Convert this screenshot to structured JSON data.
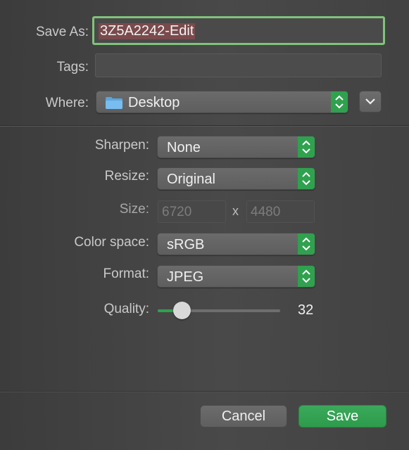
{
  "save_as": {
    "label": "Save As:",
    "value": "3Z5A2242-Edit"
  },
  "tags": {
    "label": "Tags:",
    "value": ""
  },
  "where": {
    "label": "Where:",
    "value": "Desktop",
    "icon": "folder-icon"
  },
  "sharpen": {
    "label": "Sharpen:",
    "value": "None"
  },
  "resize": {
    "label": "Resize:",
    "value": "Original"
  },
  "size": {
    "label": "Size:",
    "width": "6720",
    "separator": "x",
    "height": "4480"
  },
  "color_space": {
    "label": "Color space:",
    "value": "sRGB"
  },
  "format": {
    "label": "Format:",
    "value": "JPEG"
  },
  "quality": {
    "label": "Quality:",
    "value": "32",
    "level_fraction": 0.15
  },
  "buttons": {
    "cancel": "Cancel",
    "save": "Save"
  },
  "colors": {
    "accent": "#30a14e",
    "focus_ring": "#7fc37a",
    "selection": "#7a4a4c"
  }
}
